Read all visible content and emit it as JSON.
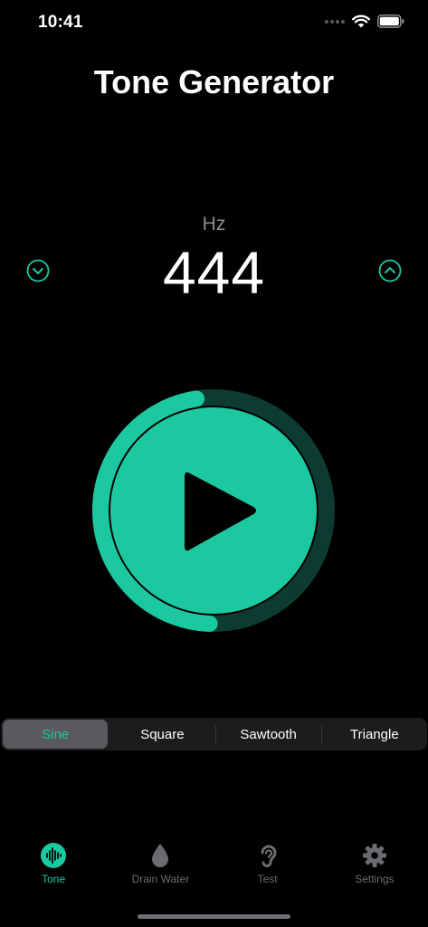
{
  "status_bar": {
    "time": "10:41"
  },
  "header": {
    "title": "Tone Generator"
  },
  "frequency": {
    "unit": "Hz",
    "value": "444"
  },
  "player": {
    "progress": 0.47
  },
  "waveforms": [
    {
      "label": "Sine",
      "selected": true
    },
    {
      "label": "Square",
      "selected": false
    },
    {
      "label": "Sawtooth",
      "selected": false
    },
    {
      "label": "Triangle",
      "selected": false
    }
  ],
  "tabs": [
    {
      "label": "Tone",
      "icon": "waveform-icon",
      "active": true
    },
    {
      "label": "Drain Water",
      "icon": "drop-icon",
      "active": false
    },
    {
      "label": "Test",
      "icon": "ear-icon",
      "active": false
    },
    {
      "label": "Settings",
      "icon": "gear-icon",
      "active": false
    }
  ],
  "colors": {
    "accent": "#1CC8A0",
    "ring_track": "#0D3B30",
    "background": "#000000"
  }
}
